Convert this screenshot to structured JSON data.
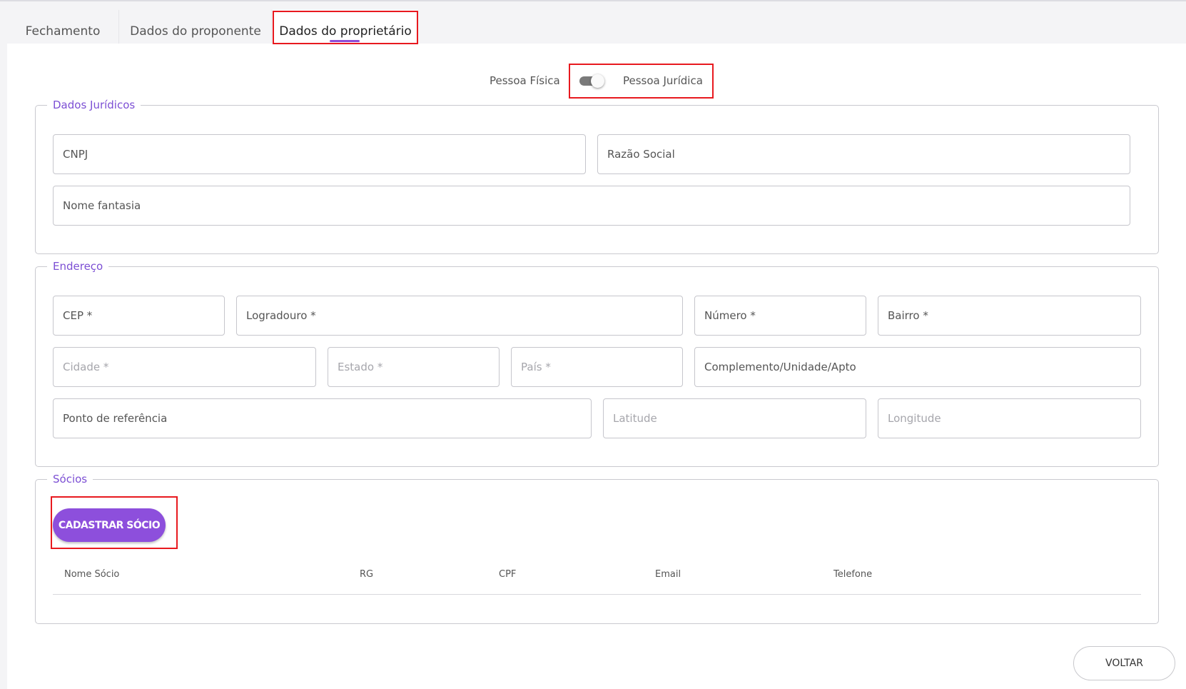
{
  "tabs": [
    {
      "label": "Fechamento"
    },
    {
      "label": "Dados do proponente"
    },
    {
      "label": "Dados do proprietário"
    }
  ],
  "toggle": {
    "left_label": "Pessoa Física",
    "right_label": "Pessoa Jurídica"
  },
  "dados_juridicos": {
    "legend": "Dados Jurídicos",
    "cnpj": "CNPJ",
    "razao_social": "Razão Social",
    "nome_fantasia": "Nome fantasia"
  },
  "endereco": {
    "legend": "Endereço",
    "cep": "CEP *",
    "logradouro": "Logradouro *",
    "numero": "Número *",
    "bairro": "Bairro *",
    "cidade": "Cidade *",
    "estado": "Estado *",
    "pais": "País *",
    "complemento": "Complemento/Unidade/Apto",
    "ponto_referencia": "Ponto de referência",
    "latitude": "Latitude",
    "longitude": "Longitude"
  },
  "socios": {
    "legend": "Sócios",
    "add_button": "CADASTRAR SÓCIO",
    "columns": [
      "Nome Sócio",
      "RG",
      "CPF",
      "Email",
      "Telefone"
    ]
  },
  "footer": {
    "back_button": "VOLTAR"
  },
  "colors": {
    "accent": "#8d4fdc",
    "legend": "#7c4fd4",
    "highlight": "#e8191f"
  }
}
